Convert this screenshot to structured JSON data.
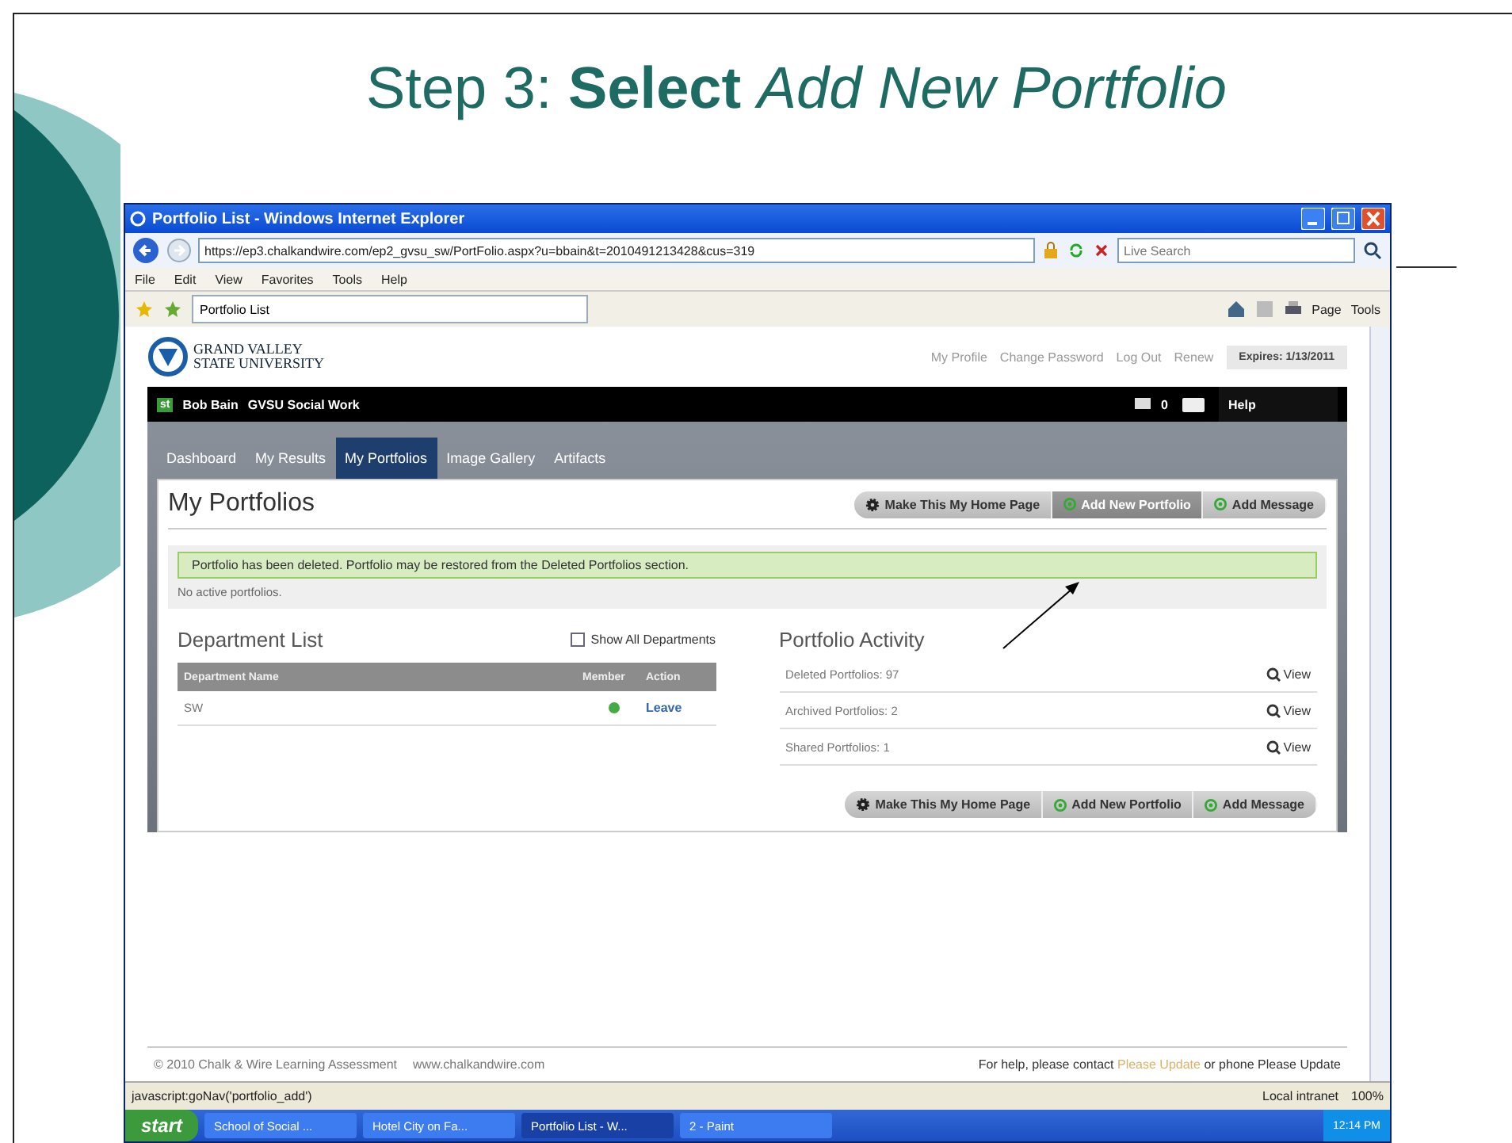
{
  "slide": {
    "title": "Step 3: **Select** *Add New Portfolio*"
  },
  "browser": {
    "window_title": "Portfolio List - Windows Internet Explorer",
    "address": "https://ep3.chalkandwire.com/ep2_gvsu_sw/PortFolio.aspx?u=bbain&t=2010491213428&cus=319",
    "search_placeholder": "Live Search",
    "menu": [
      "File",
      "Edit",
      "View",
      "Favorites",
      "Tools",
      "Help"
    ],
    "tab": "Portfolio List",
    "commands": [
      "Page",
      "Tools"
    ],
    "status_text": "javascript:goNav('portfolio_add')",
    "zone": "Local intranet",
    "zoom": "100%"
  },
  "site": {
    "logo_lines": [
      "GRAND VALLEY",
      "STATE UNIVERSITY"
    ],
    "top_links": [
      "My Profile",
      "Change Password",
      "Log Out",
      "Renew"
    ],
    "expires": "Expires: 1/13/2011",
    "user_badge": "st",
    "user": "Bob Bain",
    "program": "GVSU Social Work",
    "messages_count": "0",
    "help": "Help",
    "nav": [
      {
        "label": "Dashboard",
        "selected": false
      },
      {
        "label": "My Results",
        "selected": false
      },
      {
        "label": "My Portfolios",
        "selected": true
      },
      {
        "label": "Image Gallery",
        "selected": false
      },
      {
        "label": "Artifacts",
        "selected": false
      }
    ],
    "page_title": "My Portfolios",
    "top_buttons": [
      {
        "label": "Make This My Home Page",
        "kind": "gear",
        "disabled": false
      },
      {
        "label": "Add New Portfolio",
        "kind": "add",
        "disabled": true
      },
      {
        "label": "Add Message",
        "kind": "add",
        "disabled": false
      }
    ],
    "notice": "Portfolio has been deleted. Portfolio may be restored from the Deleted Portfolios section.",
    "empty_text": "No active portfolios.",
    "departments": {
      "title": "Department List",
      "show_all": {
        "label": "Show All Departments",
        "checked": false
      },
      "columns": [
        "Department Name",
        "Member",
        "Action"
      ],
      "rows": [
        {
          "name": "SW",
          "member": true,
          "action": "Leave"
        }
      ]
    },
    "activity": {
      "title": "Portfolio Activity",
      "rows": [
        {
          "label": "Deleted Portfolios: 97",
          "action": "View"
        },
        {
          "label": "Archived Portfolios: 2",
          "action": "View"
        },
        {
          "label": "Shared Portfolios: 1",
          "action": "View"
        }
      ]
    },
    "bottom_buttons": [
      {
        "label": "Make This My Home Page",
        "kind": "gear",
        "disabled": false
      },
      {
        "label": "Add New Portfolio",
        "kind": "add",
        "disabled": false
      },
      {
        "label": "Add Message",
        "kind": "add",
        "disabled": false
      }
    ],
    "footer": {
      "copyright": "© 2010 Chalk & Wire Learning Assessment",
      "website": "www.chalkandwire.com",
      "help_lead": "For help, please contact",
      "help_link": "Please Update",
      "help_tail": "or phone Please Update"
    }
  },
  "taskbar": {
    "start": "start",
    "tasks": [
      {
        "label": "School of Social ...",
        "selected": false
      },
      {
        "label": "Hotel City on Fa...",
        "selected": false
      },
      {
        "label": "Portfolio List - W...",
        "selected": true
      },
      {
        "label": "2 - Paint",
        "selected": false
      }
    ],
    "clock": "12:14 PM"
  }
}
